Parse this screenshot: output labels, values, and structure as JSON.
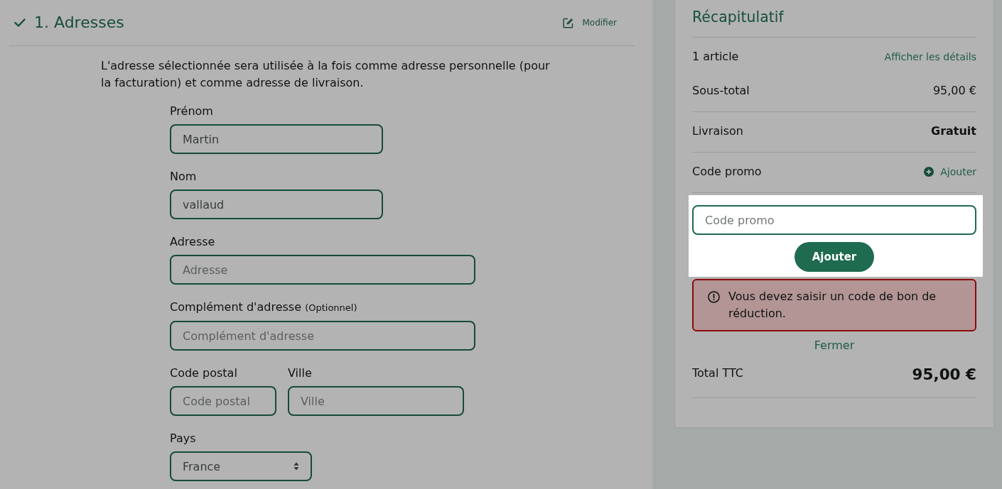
{
  "section": {
    "title": "1. Adresses",
    "completed": true,
    "edit_link": "Modifier",
    "intro": "L'adresse sélectionnée sera utilisée à la fois comme adresse personnelle (pour la facturation) et comme adresse de livraison."
  },
  "fields": [
    {
      "kind": "text",
      "label": "Prénom",
      "value": "Martin"
    },
    {
      "kind": "text",
      "label": "Nom",
      "value": "vallaud"
    },
    {
      "kind": "text",
      "label": "Adresse",
      "placeholder": "Adresse"
    },
    {
      "kind": "text",
      "label": "Complément d'adresse",
      "note": "(Optionnel)",
      "placeholder": "Complément d'adresse"
    },
    {
      "kind": "text",
      "label": "Code postal",
      "placeholder": "Code postal"
    },
    {
      "kind": "text",
      "label": "Ville",
      "placeholder": "Ville"
    },
    {
      "kind": "select",
      "label": "Pays",
      "value": "France"
    }
  ],
  "summary": {
    "title": "Récapitulatif",
    "groups": [
      {
        "lines": [
          {
            "kind": "count",
            "label": "1 article",
            "link": "Afficher les détails"
          },
          {
            "kind": "amount",
            "label": "Sous-total",
            "value": "95,00 €"
          }
        ]
      },
      {
        "lines": [
          {
            "kind": "strong",
            "label": "Livraison",
            "value": "Gratuit"
          }
        ]
      }
    ],
    "promo": {
      "label": "Code promo",
      "add_link": "Ajouter",
      "highlighted": true,
      "placeholder": "Code promo",
      "button": "Ajouter",
      "error": "Vous devez saisir un code de bon de réduction.",
      "close_link": "Fermer"
    },
    "total": {
      "label": "Total TTC",
      "value": "95,00 €"
    }
  }
}
